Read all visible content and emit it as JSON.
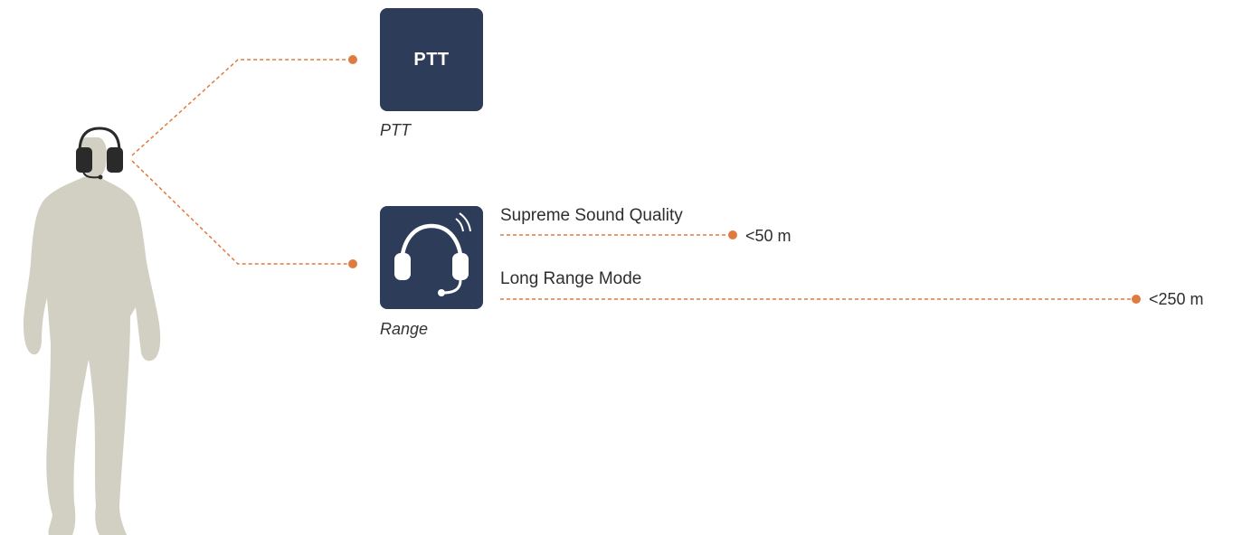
{
  "colors": {
    "accent": "#e07b3f",
    "tile": "#2d3c59",
    "silhouette": "#d2d0c2",
    "headset": "#2a2a2a"
  },
  "tiles": [
    {
      "id": "ptt",
      "text": "PTT",
      "caption": "PTT"
    },
    {
      "id": "range",
      "icon": "headset-icon",
      "caption": "Range"
    }
  ],
  "features": [
    {
      "label": "Supreme Sound Quality",
      "range": "<50 m"
    },
    {
      "label": "Long Range Mode",
      "range": "<250 m"
    }
  ],
  "figure": {
    "icon": "person-silhouette-icon",
    "headset_icon": "headset-icon"
  }
}
